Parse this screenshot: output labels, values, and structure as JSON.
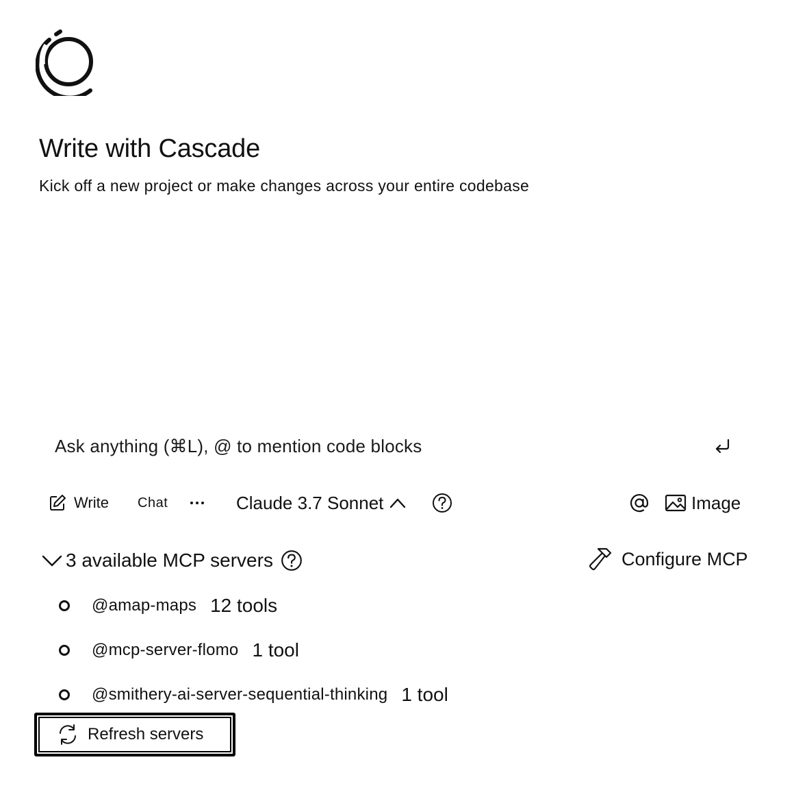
{
  "hero": {
    "title": "Write with Cascade",
    "subtitle": "Kick off a new project or make changes across your entire codebase"
  },
  "input": {
    "placeholder": "Ask anything (⌘L), @ to mention code blocks"
  },
  "toolbar": {
    "write_label": "Write",
    "chat_label": "Chat",
    "more_label": "···",
    "model_label": "Claude 3.7 Sonnet",
    "image_label": "Image"
  },
  "mcp": {
    "header_label": "3 available MCP servers",
    "configure_label": "Configure MCP",
    "servers": [
      {
        "name": "@amap-maps",
        "tools": "12 tools"
      },
      {
        "name": "@mcp-server-flomo",
        "tools": "1 tool"
      },
      {
        "name": "@smithery-ai-server-sequential-thinking",
        "tools": "1 tool"
      }
    ],
    "refresh_label": "Refresh servers"
  },
  "icons": {
    "logo": "cascade-logo",
    "enter": "enter-icon",
    "write": "pencil-icon",
    "model_chevron": "chevron-up-icon",
    "help": "question-circle-icon",
    "mention": "at-icon",
    "image": "image-icon",
    "collapse": "chevron-down-icon",
    "configure": "hammer-icon",
    "refresh": "refresh-icon"
  }
}
